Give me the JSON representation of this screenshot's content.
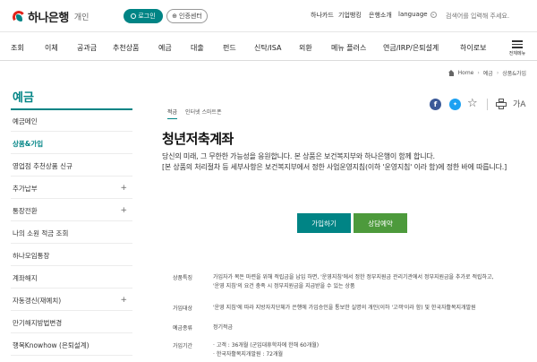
{
  "header": {
    "logo_text": "하나은행",
    "logo_sub": "개인",
    "login_label": "로그인",
    "cert_label": "인증센터",
    "util_links": [
      "하나카드",
      "기업뱅킹",
      "은행소개"
    ],
    "language_label": "language",
    "search_placeholder": "검색어를 입력해 주세요."
  },
  "gnb": {
    "items": [
      "조회",
      "이체",
      "공과금",
      "추천상품",
      "예금",
      "대출",
      "펀드",
      "신탁/ISA",
      "외환",
      "메뉴 플러스",
      "연금/IRP/은퇴설계",
      "하이로보"
    ],
    "all_menu_label": "전체메뉴"
  },
  "breadcrumb": {
    "home": "Home",
    "level1": "예금",
    "level2": "상품&가입"
  },
  "sidebar": {
    "title": "예금",
    "items": [
      {
        "label": "예금메인",
        "plus": ""
      },
      {
        "label": "상품&가입",
        "plus": ""
      },
      {
        "label": "영업점 추천상품 신규",
        "plus": ""
      },
      {
        "label": "추가납부",
        "plus": "+"
      },
      {
        "label": "통장전환",
        "plus": "+"
      },
      {
        "label": "나의 소원 적금 조회",
        "plus": ""
      },
      {
        "label": "하나모임통장",
        "plus": ""
      },
      {
        "label": "계좌해지",
        "plus": ""
      },
      {
        "label": "자동갱신(재예치)",
        "plus": "+"
      },
      {
        "label": "만기해지방법변경",
        "plus": ""
      },
      {
        "label": "행복Knowhow (은퇴설계)",
        "plus": ""
      }
    ]
  },
  "content": {
    "tabs": [
      "적금",
      "인터넷 스마트폰"
    ],
    "title": "청년저축계좌",
    "desc_line1": "당신의 미래, 그 무한한 가능성을 응원합니다. 본 상품은 보건복지부와 하나은행이 함께 합니다.",
    "desc_line2": "[본 상품의 처리절차 등 세부사항은 보건복지부에서 정한 사업운영지침(이하 '운영지침' 이라 함)에 정한 바에 따릅니다.]",
    "join_label": "가입하기",
    "consult_label": "상담예약",
    "font_size_icon_text": "가A",
    "info": [
      {
        "key": "상품특징",
        "lines": [
          "가입자가 목돈 마련을 위해 적립금을 납입 하면, '운영지침'에서 정한 정부지원금 관리기관에서 정부지원금을 추가로 적립하고,",
          "'운영 지침'의 요건 충족 시 정부지원금을 지급받을 수 있는 상품"
        ]
      },
      {
        "key": "가입대상",
        "lines": [
          "'운영 지침'에 따라 지방자치단체가 은행에 가입승인을 통보한 실명의 개인(이하 '고객'이라 함) 및 한국자활복지개발원"
        ]
      },
      {
        "key": "예금종류",
        "lines": [
          "정기적금"
        ]
      },
      {
        "key": "가입기간",
        "lines": [
          "· 고객 : 36개월 (군입대휴학자에 한해 60개월)",
          "· 한국자활복지개발원 : 72개월"
        ]
      }
    ]
  }
}
